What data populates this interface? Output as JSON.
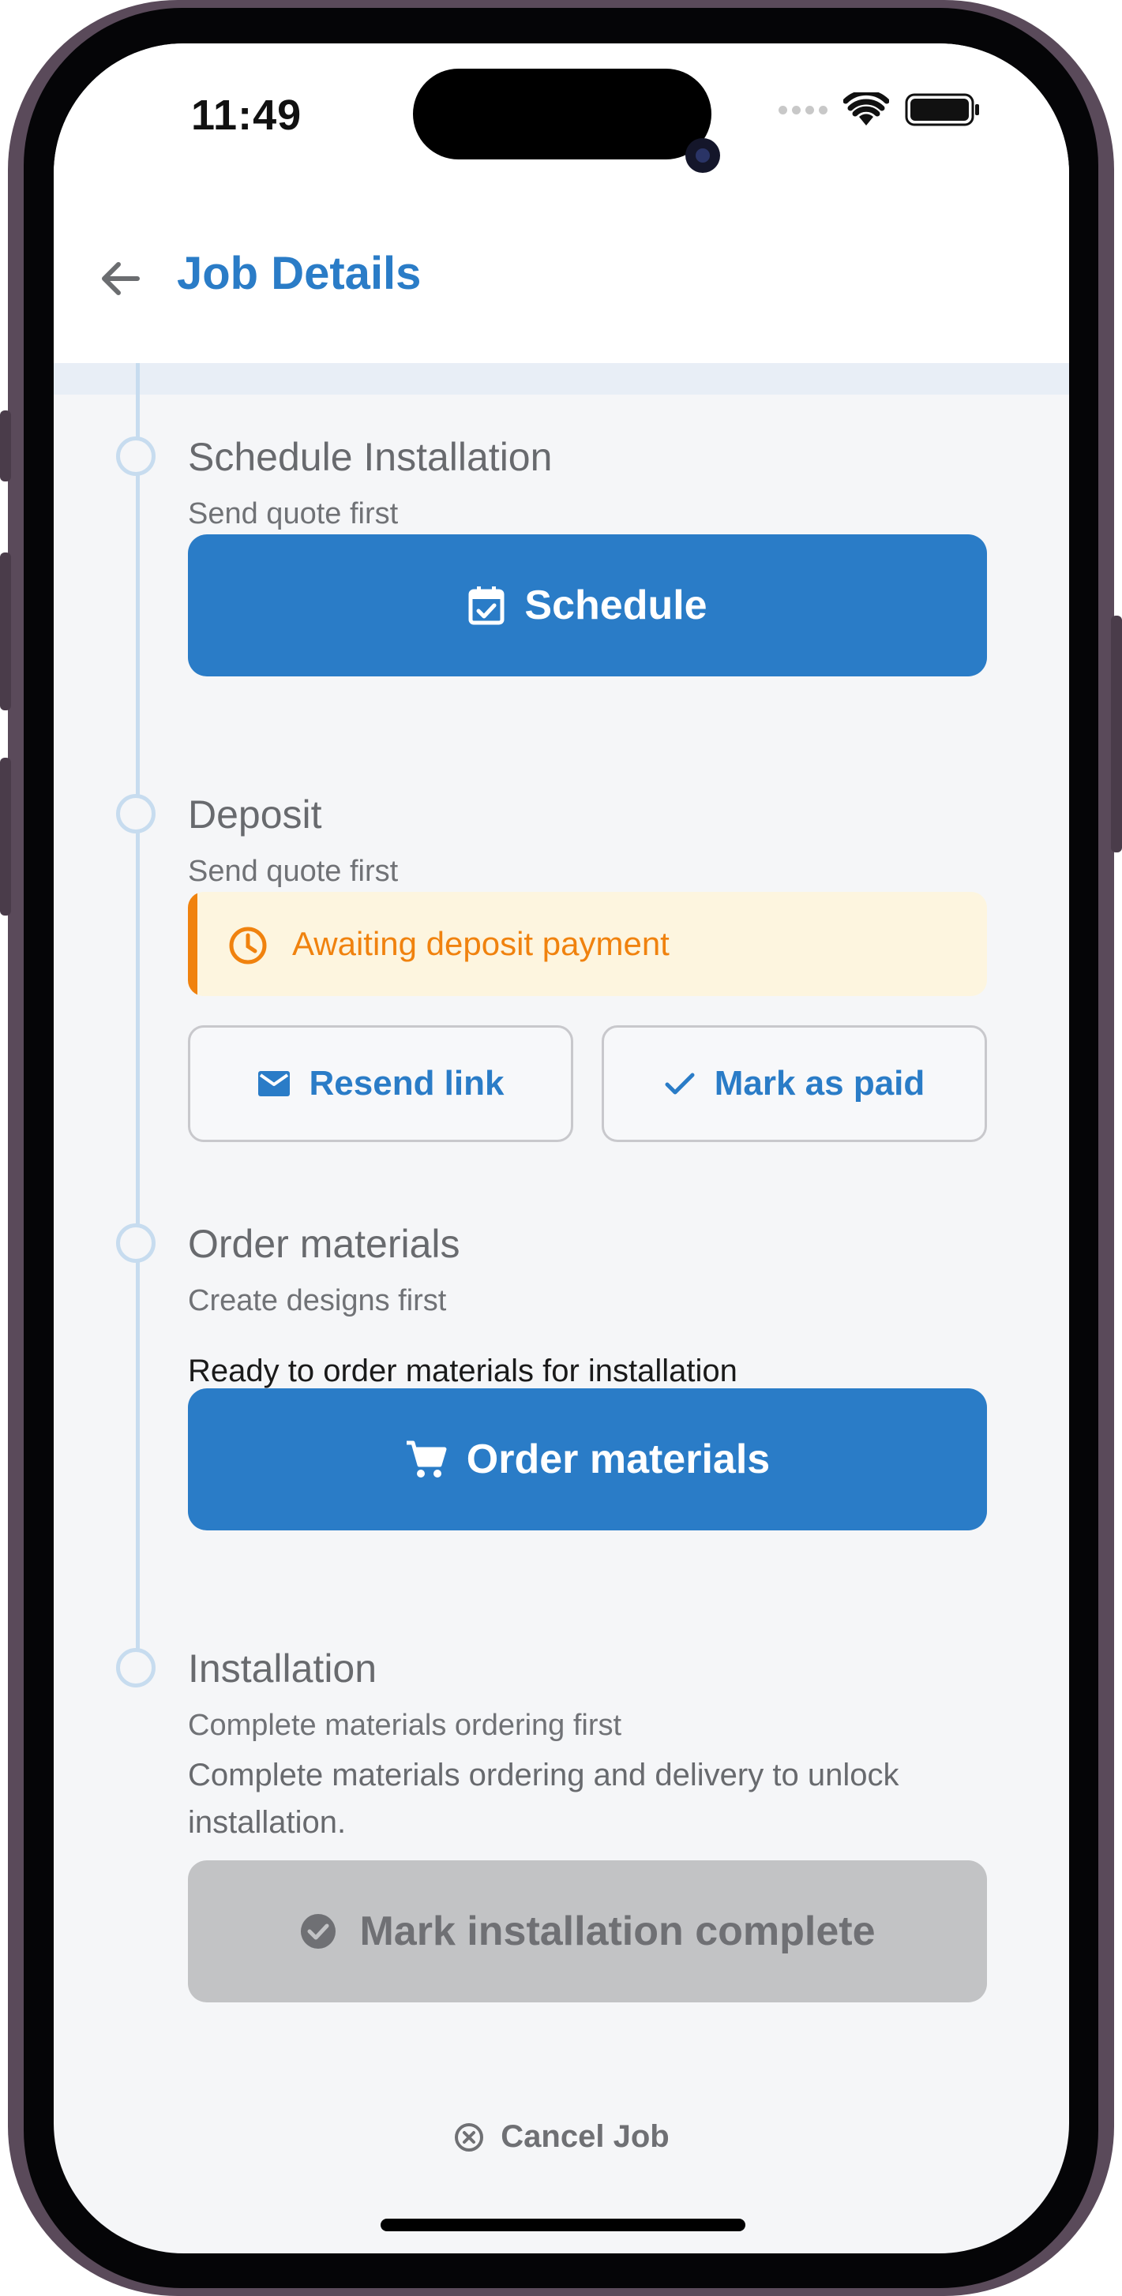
{
  "status_bar": {
    "time": "11:49"
  },
  "header": {
    "title": "Job Details"
  },
  "steps": [
    {
      "title": "Schedule Installation",
      "subtitle": "Send quote first",
      "action_label": "Schedule",
      "action_icon": "calendar-check-icon"
    },
    {
      "title": "Deposit",
      "subtitle": "Send quote first",
      "alert_text": "Awaiting deposit payment",
      "alert_icon": "clock-icon",
      "secondary_actions": [
        {
          "label": "Resend link",
          "icon": "mail-icon"
        },
        {
          "label": "Mark as paid",
          "icon": "check-icon"
        }
      ]
    },
    {
      "title": "Order materials",
      "subtitle": "Create designs first",
      "body": "Ready to order materials for installation",
      "action_label": "Order materials",
      "action_icon": "cart-icon"
    },
    {
      "title": "Installation",
      "subtitle": "Complete materials ordering first",
      "body": "Complete materials ordering and delivery to unlock installation.",
      "action_label": "Mark installation complete",
      "action_icon": "check-circle-icon",
      "action_disabled": true
    }
  ],
  "footer": {
    "cancel_label": "Cancel Job",
    "cancel_icon": "x-circle-icon"
  },
  "colors": {
    "primary": "#2a7cc7",
    "warning": "#f0820e",
    "warning_bg": "#fdf5df",
    "disabled_bg": "#c2c3c5",
    "timeline": "#c7dcef"
  }
}
